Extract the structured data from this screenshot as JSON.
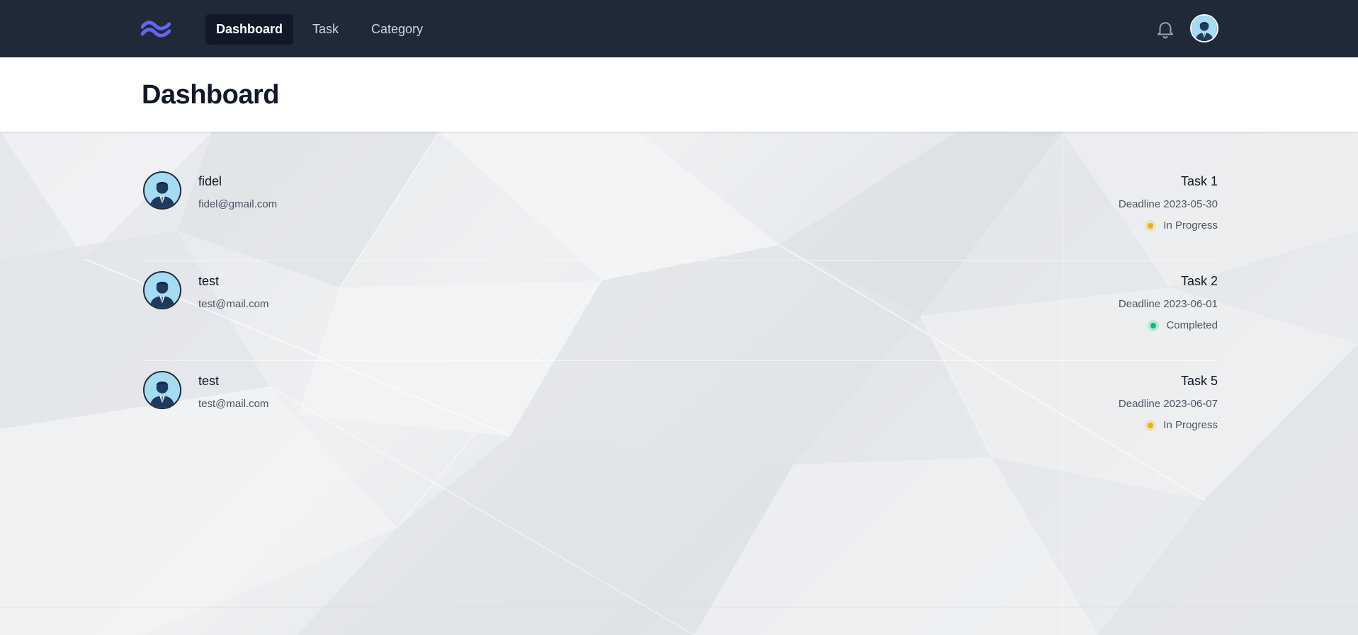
{
  "nav": {
    "logo_icon": "tailwind-wave-logo",
    "links": [
      {
        "label": "Dashboard",
        "active": true
      },
      {
        "label": "Task",
        "active": false
      },
      {
        "label": "Category",
        "active": false
      }
    ],
    "notification_icon": "bell-icon",
    "profile_icon": "avatar"
  },
  "header": {
    "title": "Dashboard"
  },
  "rows": [
    {
      "user": {
        "name": "fidel",
        "email": "fidel@gmail.com"
      },
      "task": {
        "name": "Task 1",
        "deadline_text": "Deadline 2023-05-30",
        "status": "In Progress",
        "status_color": "#eab308"
      }
    },
    {
      "user": {
        "name": "test",
        "email": "test@mail.com"
      },
      "task": {
        "name": "Task 2",
        "deadline_text": "Deadline 2023-06-01",
        "status": "Completed",
        "status_color": "#10b981"
      }
    },
    {
      "user": {
        "name": "test",
        "email": "test@mail.com"
      },
      "task": {
        "name": "Task 5",
        "deadline_text": "Deadline 2023-06-07",
        "status": "In Progress",
        "status_color": "#eab308"
      }
    }
  ],
  "colors": {
    "navbar_bg": "#1f2937",
    "active_link_bg": "#111827",
    "logo": "#6366f1",
    "in_progress": "#eab308",
    "completed": "#10b981"
  }
}
